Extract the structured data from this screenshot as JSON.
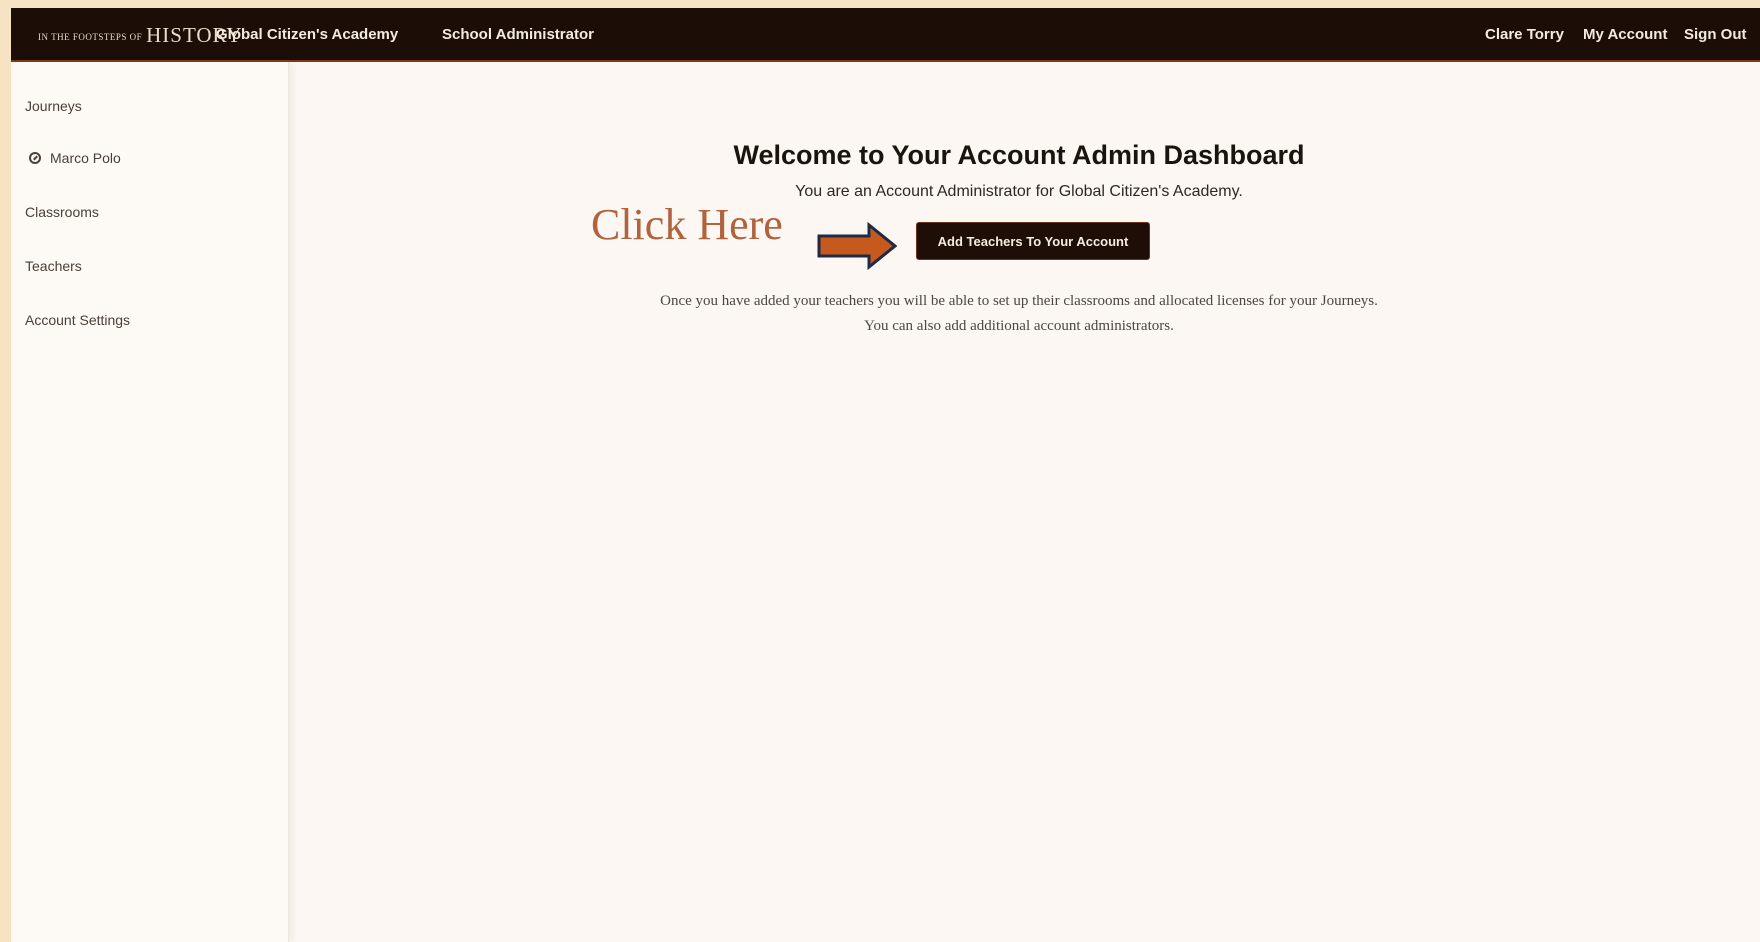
{
  "header": {
    "logo_small": "In The Footsteps Of",
    "logo_big": "History",
    "org_name": "Global Citizen's Academy",
    "role": "School Administrator",
    "user_name": "Clare Torry",
    "my_account": "My Account",
    "sign_out": "Sign Out"
  },
  "sidebar": {
    "journeys": "Journeys",
    "journey_item": "Marco Polo",
    "classrooms": "Classrooms",
    "teachers": "Teachers",
    "account_settings": "Account Settings"
  },
  "main": {
    "title": "Welcome to Your Account Admin Dashboard",
    "subtitle": "You are an Account Administrator for Global Citizen's Academy.",
    "callout": "Click Here",
    "cta_button": "Add Teachers To Your Account",
    "info_line1": "Once you have added your teachers you will be able to set up their classrooms and allocated licenses for your Journeys.",
    "info_line2": "You can also add additional account administrators."
  },
  "colors": {
    "header_bg": "#1c0d06",
    "page_bg": "#fcf7f2",
    "outer_bg": "#f6e3c4",
    "arrow_fill": "#c65a1e",
    "arrow_stroke": "#1f2a44",
    "callout_text": "#b0633d"
  },
  "icons": {
    "journey_item_icon": "compass-icon",
    "callout_arrow": "arrow-right-icon"
  }
}
